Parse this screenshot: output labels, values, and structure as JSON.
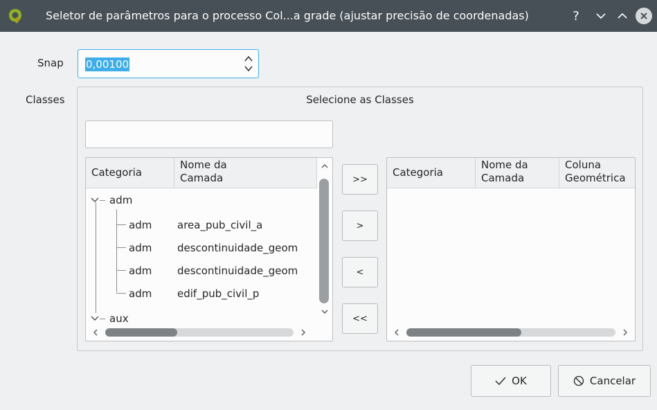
{
  "titlebar": {
    "title": "Seletor de parâmetros para o processo Col...a grade (ajustar precisão de coordenadas)",
    "help": "?"
  },
  "snap": {
    "label": "Snap",
    "value": "0,00100"
  },
  "classes": {
    "label": "Classes",
    "group_title": "Selecione as Classes",
    "filter_value": "",
    "available": {
      "headers": [
        [
          "Categoria"
        ],
        [
          "Nome da",
          "Camada"
        ]
      ],
      "groups": [
        {
          "name": "adm",
          "expanded": true,
          "children": [
            {
              "categoria": "adm",
              "camada": "area_pub_civil_a"
            },
            {
              "categoria": "adm",
              "camada": "descontinuidade_geom"
            },
            {
              "categoria": "adm",
              "camada": "descontinuidade_geom"
            },
            {
              "categoria": "adm",
              "camada": "edif_pub_civil_p"
            }
          ]
        },
        {
          "name": "aux",
          "expanded": true,
          "children": []
        }
      ]
    },
    "selected": {
      "headers": [
        [
          "Categoria"
        ],
        [
          "Nome da",
          "Camada"
        ],
        [
          "Coluna",
          "Geométrica"
        ]
      ],
      "rows": []
    },
    "move_buttons": {
      "add_all": ">>",
      "add": ">",
      "remove": "<",
      "remove_all": "<<"
    }
  },
  "buttons": {
    "ok": "OK",
    "cancel": "Cancelar"
  },
  "colors": {
    "titlebar_bg": "#475057",
    "selection": "#3daee9",
    "window_bg": "#eff0f1"
  }
}
